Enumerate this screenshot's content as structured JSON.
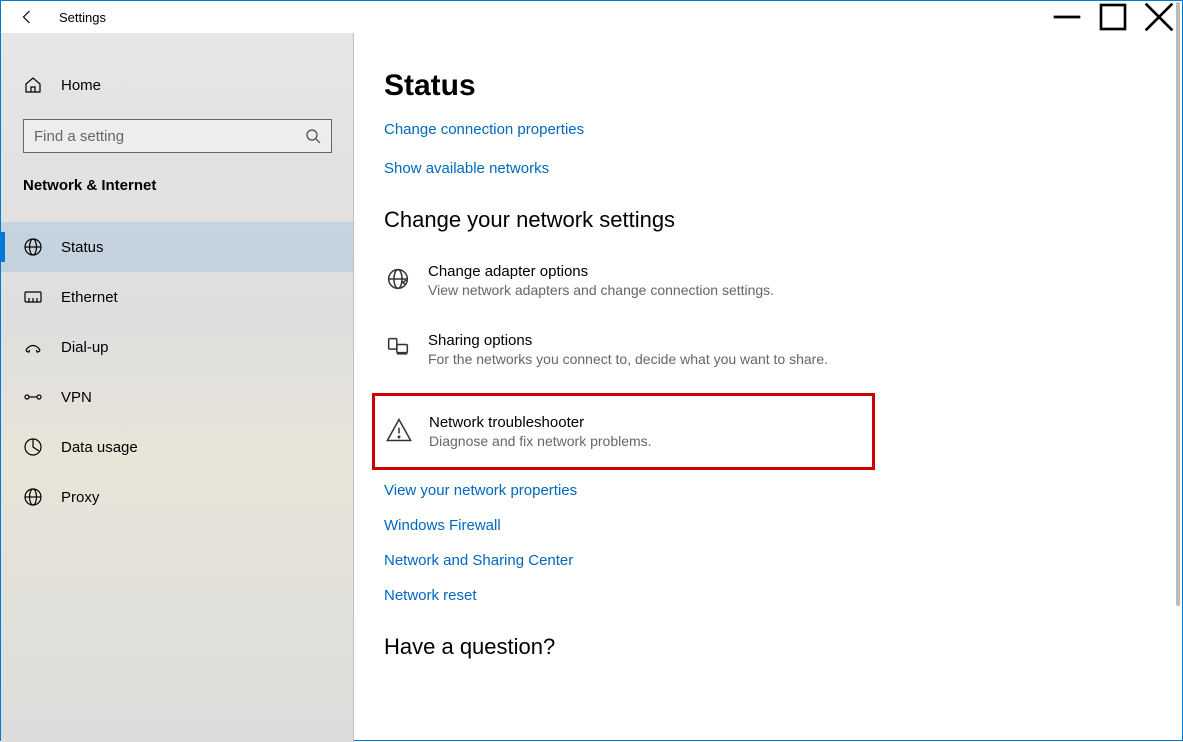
{
  "window": {
    "title": "Settings"
  },
  "sidebar": {
    "home": "Home",
    "search_placeholder": "Find a setting",
    "category": "Network & Internet",
    "items": [
      {
        "label": "Status",
        "icon": "globe-icon",
        "selected": true
      },
      {
        "label": "Ethernet",
        "icon": "ethernet-icon",
        "selected": false
      },
      {
        "label": "Dial-up",
        "icon": "dialup-icon",
        "selected": false
      },
      {
        "label": "VPN",
        "icon": "vpn-icon",
        "selected": false
      },
      {
        "label": "Data usage",
        "icon": "data-icon",
        "selected": false
      },
      {
        "label": "Proxy",
        "icon": "proxy-icon",
        "selected": false
      }
    ]
  },
  "main": {
    "title": "Status",
    "links_top": {
      "conn_props": "Change connection properties",
      "show_networks": "Show available networks"
    },
    "section_heading": "Change your network settings",
    "options": {
      "adapter": {
        "title": "Change adapter options",
        "desc": "View network adapters and change connection settings."
      },
      "sharing": {
        "title": "Sharing options",
        "desc": "For the networks you connect to, decide what you want to share."
      },
      "trouble": {
        "title": "Network troubleshooter",
        "desc": "Diagnose and fix network problems."
      }
    },
    "links_bottom": {
      "view_props": "View your network properties",
      "firewall": "Windows Firewall",
      "sharing_center": "Network and Sharing Center",
      "reset": "Network reset"
    },
    "footer_heading": "Have a question?"
  }
}
